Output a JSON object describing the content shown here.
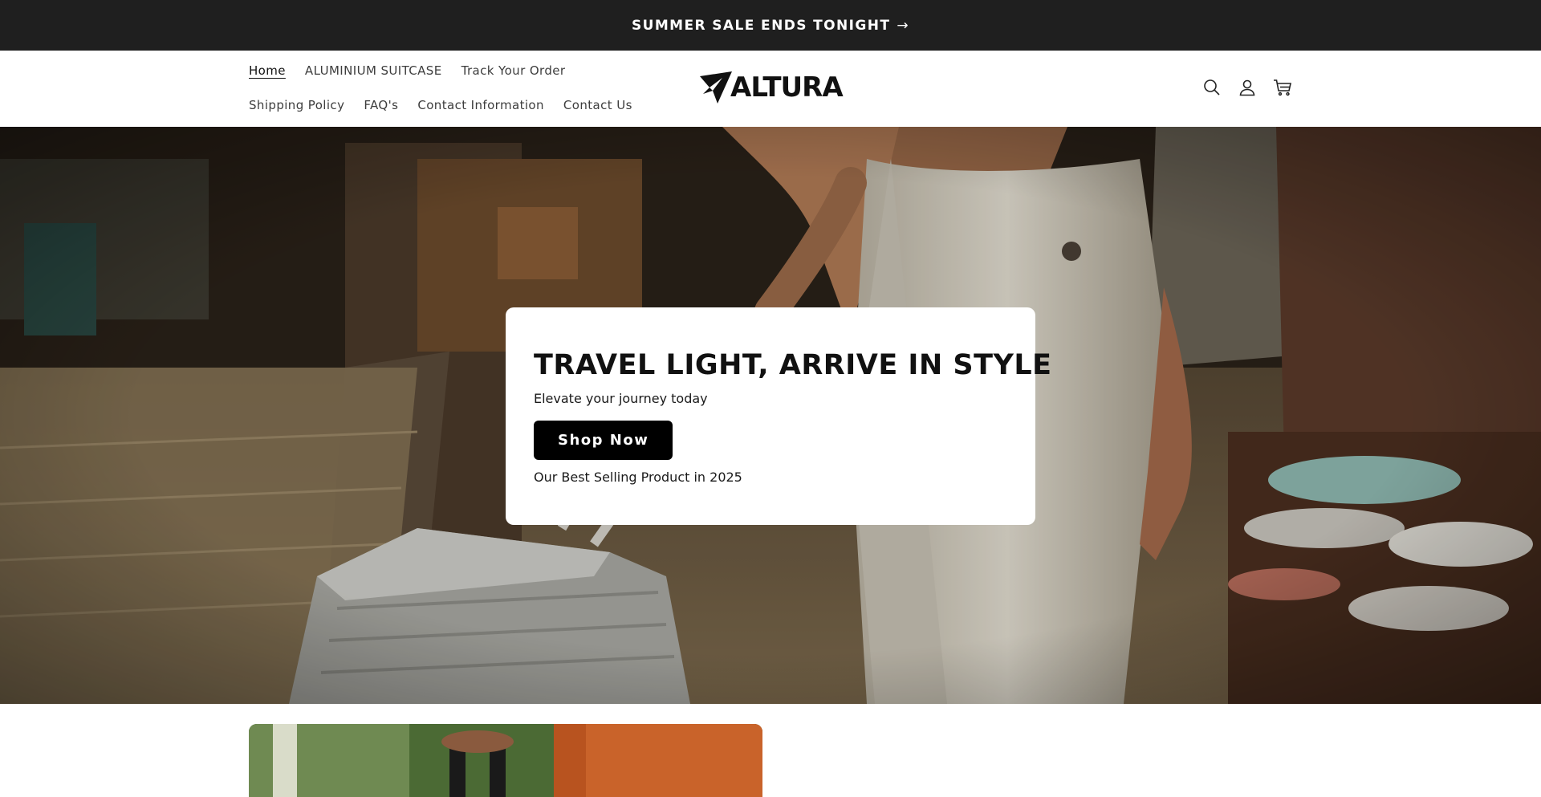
{
  "announcement": {
    "text": "SUMMER SALE ENDS TONIGHT",
    "arrow": "→"
  },
  "header": {
    "nav_row1": [
      {
        "label": "Home",
        "active": true
      },
      {
        "label": "ALUMINIUM SUITCASE",
        "active": false
      },
      {
        "label": "Track Your Order",
        "active": false
      }
    ],
    "nav_row2": [
      {
        "label": "Shipping Policy",
        "active": false
      },
      {
        "label": "FAQ's",
        "active": false
      },
      {
        "label": "Contact Information",
        "active": false
      },
      {
        "label": "Contact Us",
        "active": false
      }
    ],
    "logo_text": "ALTURA",
    "icons": [
      "search-icon",
      "account-icon",
      "cart-icon"
    ]
  },
  "hero": {
    "title": "TRAVEL LIGHT, ARRIVE IN STYLE",
    "subtitle": "Elevate your journey today",
    "button_label": "Shop Now",
    "note": "Our Best Selling Product in 2025"
  },
  "colors": {
    "announcement_bg": "#1f1f1f",
    "button_bg": "#000000",
    "card_bg": "#ffffff"
  }
}
